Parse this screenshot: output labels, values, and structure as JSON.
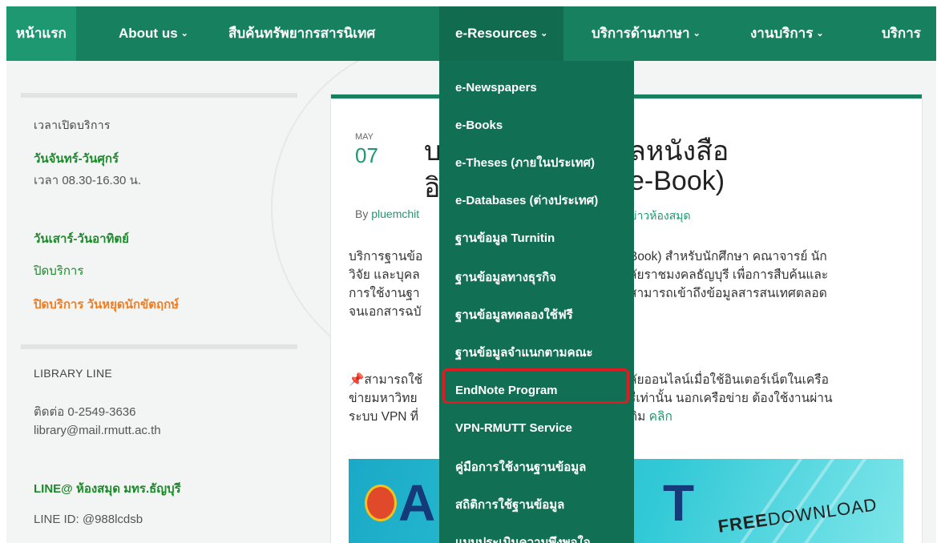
{
  "nav": {
    "items": [
      {
        "label": "หน้าแรก",
        "caret": false
      },
      {
        "label": "About us",
        "caret": true
      },
      {
        "label": "สืบค้นทรัพยากรสารนิเทศ",
        "caret": false
      },
      {
        "label": "e-Resources",
        "caret": true
      },
      {
        "label": "บริการด้านภาษา",
        "caret": true
      },
      {
        "label": "งานบริการ",
        "caret": true
      },
      {
        "label": "บริการ",
        "caret": false
      }
    ],
    "caret_glyph": "⌄"
  },
  "dropdown": {
    "items": [
      "e-Newspapers",
      "e-Books",
      "e-Theses (ภายในประเทศ)",
      "e-Databases (ต่างประเทศ)",
      "ฐานข้อมูล Turnitin",
      "ฐานข้อมูลทางธุรกิจ",
      "ฐานข้อมูลทดลองใช้ฟรี",
      "ฐานข้อมูลจำแนกตามคณะ",
      "EndNote Program",
      "VPN-RMUTT Service",
      "คู่มือการใช้งานฐานข้อมูล",
      "สถิติการใช้ฐานข้อมูล",
      "แบบประเมินความพึงพอใจ"
    ],
    "highlighted": "EndNote Program",
    "highlight_color": "#e01b24"
  },
  "sidebar": {
    "hours_title": "เวลาเปิดบริการ",
    "weekday_label": "วันจันทร์-วันศุกร์",
    "weekday_time": "เวลา 08.30-16.30 น.",
    "weekend_label": "วันเสาร์-วันอาทิตย์",
    "weekend_status": "ปิดบริการ",
    "holiday_note": "ปิดบริการ วันหยุดนักขัตฤกษ์",
    "line_title": "LIBRARY LINE",
    "phone": "ติดต่อ 0-2549-3636",
    "email": "library@mail.rmutt.ac.th",
    "line_at": "LINE@ ห้องสมุด มทร.ธัญบุรี",
    "line_id": "LINE ID: @988lcdsb"
  },
  "article": {
    "month": "MAY",
    "day": "07",
    "title_line1_start": "บ",
    "title_line1_end": "ลหนังสือ",
    "title_line2_start": "อิ",
    "title_line2_end": "e-Book)",
    "author_prefix": "By",
    "author": "pluemchit",
    "category": "ข่าวห้องสมุด",
    "para1_left": [
      "บริการฐานข้อ",
      "วิจัย และบุคล",
      "การใช้งานฐา",
      "จนเอกสารฉบั"
    ],
    "para1_right": [
      "Book) สำหรับนักศึกษา คณาจารย์ นัก",
      "ลัยราชมงคลธัญบุรี เพื่อการสืบค้นและ",
      "สามารถเข้าถึงข้อมูลสารสนเทศตลอด"
    ],
    "para2_left": [
      "สามารถใช้",
      "ข่ายมหาวิทย",
      "ระบบ VPN ที่"
    ],
    "para2_right": [
      "ลัยออนไลน์เมื่อใช้อินเตอร์เน็ตในเครือ",
      "รีเท่านั้น นอกเครือข่าย ต้องใช้งานผ่าน",
      "ดิม"
    ],
    "link_text": "คลิก",
    "banner_big_left": "A",
    "banner_big_right": "T",
    "banner_free": "FREE",
    "banner_download": "DOWNLOAD"
  },
  "colors": {
    "nav_bg": "#17805f",
    "dropdown_bg": "#117053",
    "accent_green": "#1c8a2a",
    "accent_orange": "#ef7d22"
  },
  "icons": {
    "pin": "pushpin-icon"
  }
}
